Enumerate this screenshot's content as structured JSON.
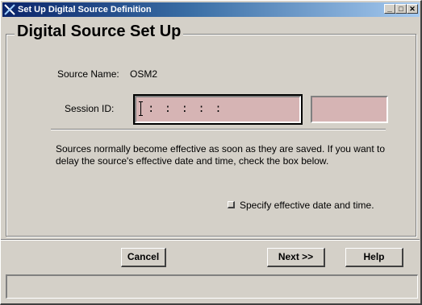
{
  "window": {
    "title": "Set Up Digital Source Definition",
    "controls": {
      "minimize": "_",
      "maximize": "□",
      "close": "✕"
    }
  },
  "group": {
    "title": "Digital Source Set Up"
  },
  "form": {
    "source_name_label": "Source Name:",
    "source_name_value": "OSM2",
    "session_id_label": "Session ID:",
    "session_id_value": ": : : : :",
    "session_extra_value": ""
  },
  "description": "Sources normally become effective as soon as they are saved.  If you want to delay the source's effective date and time, check the box below.",
  "checkbox": {
    "label": "Specify effective date and time.",
    "checked": false
  },
  "buttons": {
    "cancel": "Cancel",
    "next": "Next >>",
    "help": "Help"
  },
  "status": {
    "text": ""
  },
  "colors": {
    "field_bg": "#d6b4b4",
    "title_bar_start": "#0a246a",
    "title_bar_end": "#a6caf0",
    "window_bg": "#d4d0c8"
  }
}
